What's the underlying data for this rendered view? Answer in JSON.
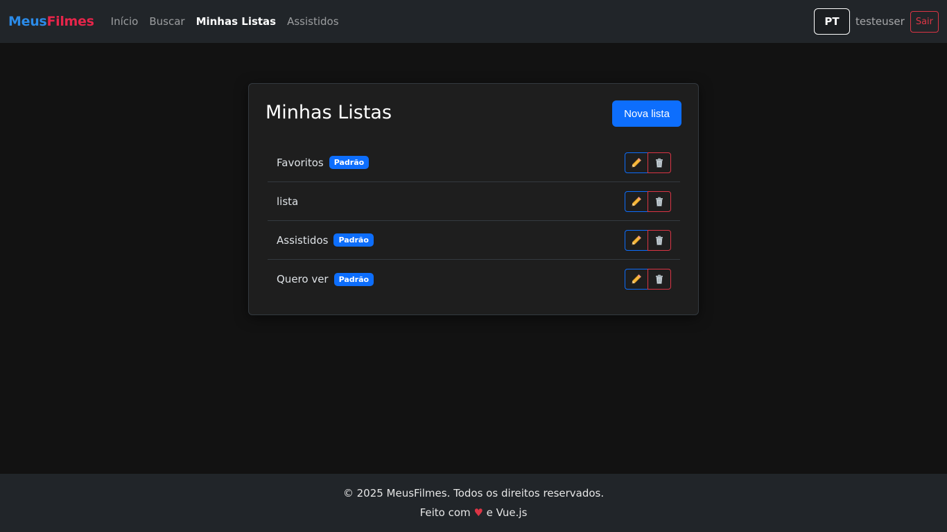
{
  "navbar": {
    "brand_part1": "Meus",
    "brand_part2": "Filmes",
    "links": [
      "Início",
      "Buscar",
      "Minhas Listas",
      "Assistidos"
    ],
    "active_link": "Minhas Listas",
    "language": "PT",
    "username": "testeuser",
    "logout_label": "Sair"
  },
  "main": {
    "title": "Minhas Listas",
    "new_list_label": "Nova lista",
    "lists": [
      {
        "name": "Favoritos",
        "badge": "Padrão"
      },
      {
        "name": "lista",
        "badge": ""
      },
      {
        "name": "Assistidos",
        "badge": "Padrão"
      },
      {
        "name": "Quero ver",
        "badge": "Padrão"
      }
    ]
  },
  "footer": {
    "copyright": "© 2025 MeusFilmes. Todos os direitos reservados.",
    "made_with_prefix": "Feito com",
    "heart": "♥",
    "made_with_suffix": "e Vue.js"
  },
  "colors": {
    "primary": "#0d6efd",
    "danger": "#dc3545",
    "brand_blue": "#2b8be8",
    "brand_red": "#e6254a"
  },
  "icons": {
    "edit": "pencil-icon",
    "delete": "trash-icon"
  }
}
